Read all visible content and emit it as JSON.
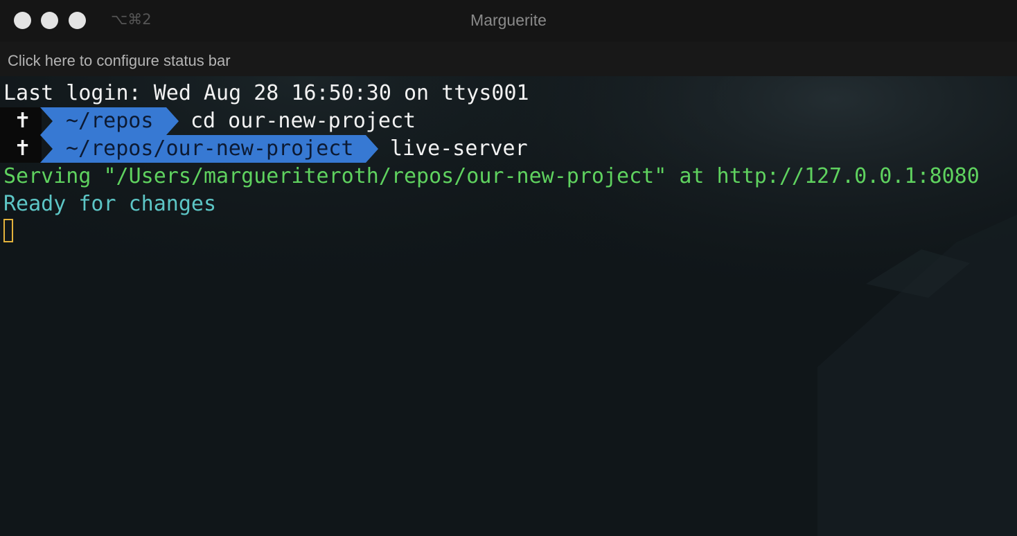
{
  "window": {
    "title": "Marguerite",
    "shortcut": "⌥⌘2",
    "traffic_lights_color": "#e3e3e3"
  },
  "status_bar": {
    "text": "Click here to configure status bar"
  },
  "terminal": {
    "last_login": "Last login: Wed Aug 28 16:50:30 on ttys001",
    "prompts": [
      {
        "symbol": "✝",
        "path": "~/repos",
        "command": "cd our-new-project"
      },
      {
        "symbol": "✝",
        "path": "~/repos/our-new-project",
        "command": "live-server"
      }
    ],
    "output": [
      {
        "text": "Serving \"/Users/margueriteroth/repos/our-new-project\" at http://127.0.0.1:8080",
        "color": "#5fd25f"
      },
      {
        "text": "Ready for changes",
        "color": "#5dc6c6"
      }
    ],
    "colors": {
      "prompt_path_bg": "#3779d3",
      "prompt_symbol_bg": "#0a0a0a",
      "cursor": "#e3b23c"
    }
  }
}
